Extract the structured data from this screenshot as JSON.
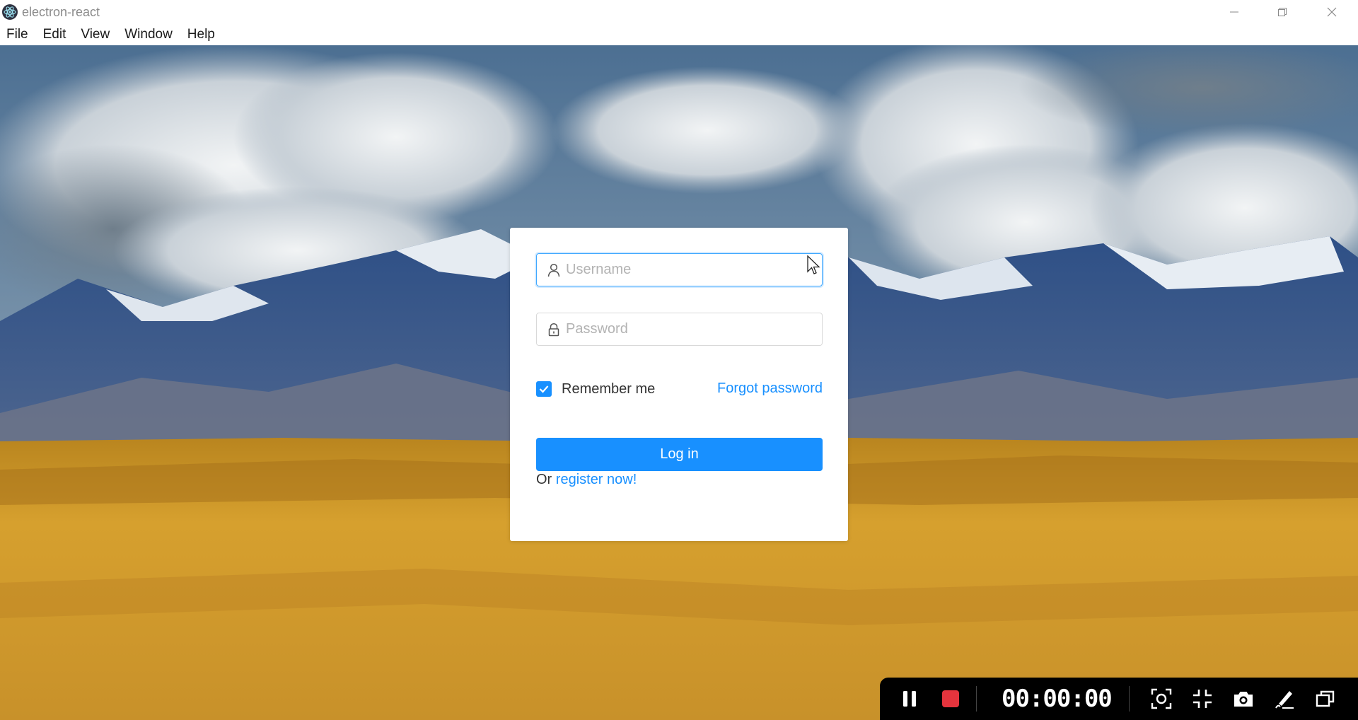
{
  "window": {
    "title": "electron-react",
    "app_icon": "electron-atom-icon",
    "controls": [
      "minimize-icon",
      "restore-icon",
      "close-icon"
    ]
  },
  "menu": {
    "items": [
      {
        "label": "File"
      },
      {
        "label": "Edit"
      },
      {
        "label": "View"
      },
      {
        "label": "Window"
      },
      {
        "label": "Help"
      }
    ]
  },
  "login": {
    "username_placeholder": "Username",
    "username_value": "",
    "password_placeholder": "Password",
    "password_value": "",
    "remember_label": "Remember me",
    "remember_checked": true,
    "forgot_label": "Forgot password",
    "login_label": "Log in",
    "register_prefix": "Or",
    "register_label": "register now!"
  },
  "recorder": {
    "time": "00:00:00",
    "controls": [
      "pause-icon",
      "stop-icon",
      "region-capture-icon",
      "exit-fullscreen-icon",
      "camera-icon",
      "pen-icon",
      "window-switch-icon"
    ]
  },
  "colors": {
    "accent": "#1890ff",
    "stop_red": "#e5343d",
    "recorder_bg": "#000000"
  }
}
